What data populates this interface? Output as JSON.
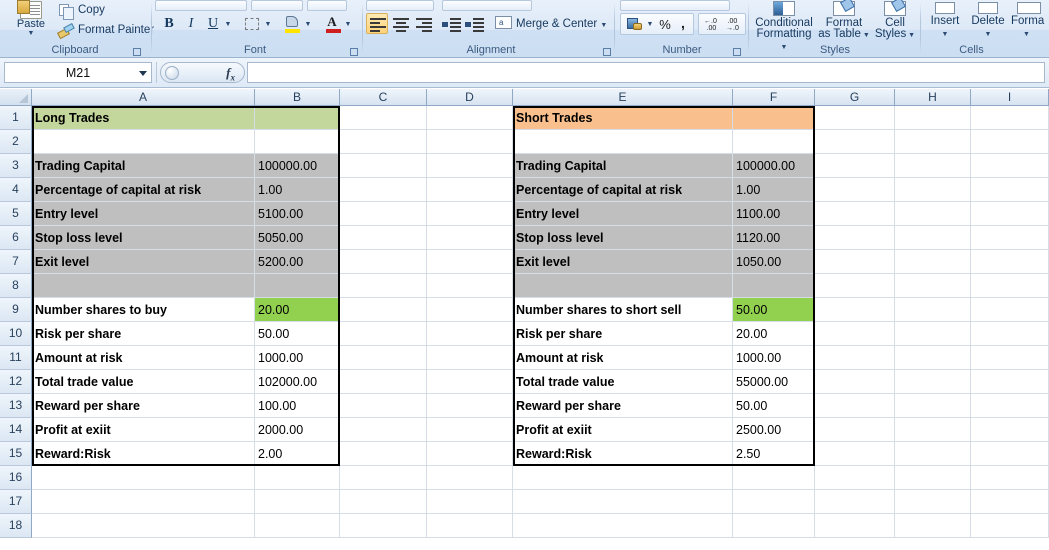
{
  "ribbon": {
    "groups": [
      {
        "name": "clipboard",
        "label": "Clipboard"
      },
      {
        "name": "font",
        "label": "Font"
      },
      {
        "name": "alignment",
        "label": "Alignment"
      },
      {
        "name": "number",
        "label": "Number"
      },
      {
        "name": "styles",
        "label": "Styles"
      },
      {
        "name": "cells",
        "label": "Cells"
      }
    ],
    "clipboard": {
      "paste": "Paste",
      "copy": "Copy",
      "format_painter": "Format Painter"
    },
    "font": {
      "bold": "B",
      "italic": "I",
      "underline": "U"
    },
    "alignment": {
      "merge_center": "Merge & Center"
    },
    "number": {
      "percent": "%",
      "comma": ","
    },
    "styles": {
      "conditional_formatting_line1": "Conditional",
      "conditional_formatting_line2": "Formatting",
      "format_as_table_line1": "Format",
      "format_as_table_line2": "as Table",
      "cell_styles_line1": "Cell",
      "cell_styles_line2": "Styles"
    },
    "cells": {
      "insert": "Insert",
      "delete": "Delete",
      "format": "Forma"
    }
  },
  "formula_bar": {
    "name_box": "M21",
    "formula": "",
    "fx_label": "fx"
  },
  "sheet": {
    "columns": [
      "A",
      "B",
      "C",
      "D",
      "E",
      "F",
      "G",
      "H",
      "I"
    ],
    "rows": [
      "1",
      "2",
      "3",
      "4",
      "5",
      "6",
      "7",
      "8",
      "9",
      "10",
      "11",
      "12",
      "13",
      "14",
      "15",
      "16",
      "17",
      "18"
    ],
    "colors": {
      "long_header_bg": "#C3D69B",
      "short_header_bg": "#F9C08E",
      "input_block_bg": "#BFBFBF",
      "result_highlight_bg": "#92D050",
      "grid_line": "#D6DDE6"
    },
    "long_table": {
      "title": "Long Trades",
      "inputs": [
        {
          "label": "Trading Capital",
          "value": "100000.00"
        },
        {
          "label": "Percentage of capital at risk",
          "value": "1.00"
        },
        {
          "label": "Entry level",
          "value": "5100.00"
        },
        {
          "label": "Stop loss level",
          "value": "5050.00"
        },
        {
          "label": "Exit level",
          "value": "5200.00"
        }
      ],
      "outputs": [
        {
          "label": "Number shares to buy",
          "value": "20.00",
          "highlight": true
        },
        {
          "label": "Risk per share",
          "value": "50.00",
          "highlight": false
        },
        {
          "label": "Amount at risk",
          "value": "1000.00",
          "highlight": false
        },
        {
          "label": "Total trade value",
          "value": "102000.00",
          "highlight": false
        },
        {
          "label": "Reward per share",
          "value": "100.00",
          "highlight": false
        },
        {
          "label": "Profit at exiit",
          "value": "2000.00",
          "highlight": false
        },
        {
          "label": "Reward:Risk",
          "value": "2.00",
          "highlight": false
        }
      ]
    },
    "short_table": {
      "title": "Short Trades",
      "inputs": [
        {
          "label": "Trading Capital",
          "value": "100000.00"
        },
        {
          "label": "Percentage of capital at risk",
          "value": "1.00"
        },
        {
          "label": "Entry level",
          "value": "1100.00"
        },
        {
          "label": "Stop loss level",
          "value": "1120.00"
        },
        {
          "label": "Exit level",
          "value": "1050.00"
        }
      ],
      "outputs": [
        {
          "label": "Number shares to short sell",
          "value": "50.00",
          "highlight": true
        },
        {
          "label": "Risk per share",
          "value": "20.00",
          "highlight": false
        },
        {
          "label": "Amount at risk",
          "value": "1000.00",
          "highlight": false
        },
        {
          "label": "Total trade value",
          "value": "55000.00",
          "highlight": false
        },
        {
          "label": "Reward per share",
          "value": "50.00",
          "highlight": false
        },
        {
          "label": "Profit at exiit",
          "value": "2500.00",
          "highlight": false
        },
        {
          "label": "Reward:Risk",
          "value": "2.50",
          "highlight": false
        }
      ]
    }
  }
}
